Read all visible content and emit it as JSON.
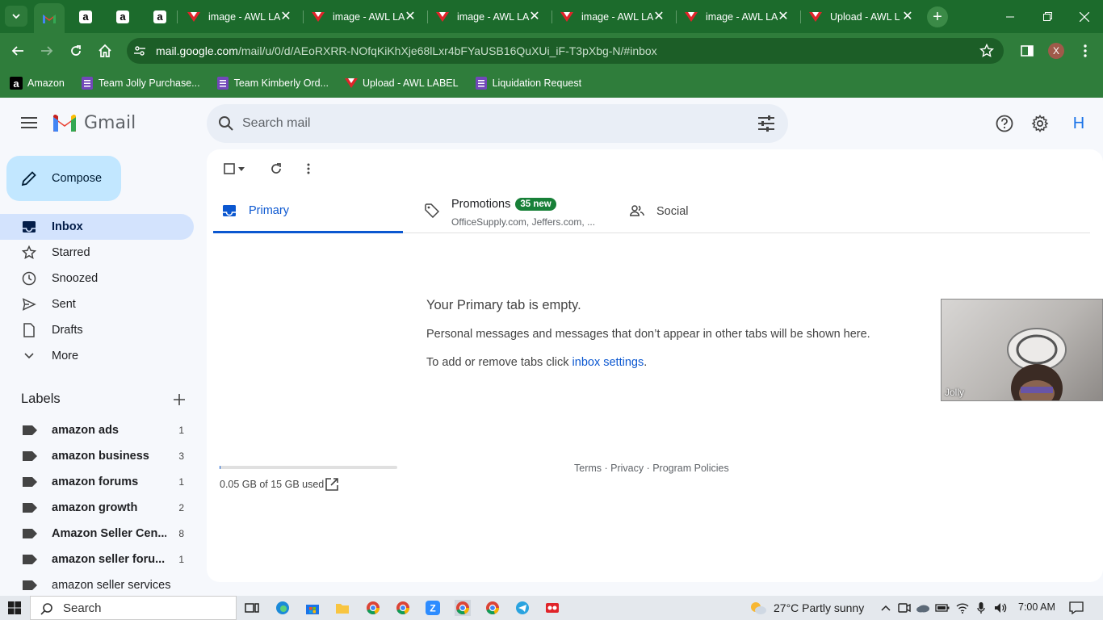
{
  "browser": {
    "tabs": [
      {
        "title": "",
        "icon": "gmail-favicon"
      },
      {
        "title": "",
        "icon": "amazon-favicon"
      },
      {
        "title": "",
        "icon": "amazon-favicon"
      },
      {
        "title": "",
        "icon": "amazon-favicon"
      },
      {
        "title": "image - AWL LA",
        "icon": "awl-favicon"
      },
      {
        "title": "image - AWL LA",
        "icon": "awl-favicon"
      },
      {
        "title": "image - AWL LA",
        "icon": "awl-favicon"
      },
      {
        "title": "image - AWL LA",
        "icon": "awl-favicon"
      },
      {
        "title": "image - AWL LA",
        "icon": "awl-favicon"
      },
      {
        "title": "Upload - AWL L",
        "icon": "awl-favicon"
      }
    ],
    "url_host": "mail.google.com",
    "url_path": "/mail/u/0/d/AEoRXRR-NOfqKiKhXje68lLxr4bFYaUSB16QuXUi_iF-T3pXbg-N/#inbox",
    "profile_initial": "X",
    "bookmarks": [
      {
        "label": "Amazon",
        "icon": "amazon-icon"
      },
      {
        "label": "Team Jolly Purchase...",
        "icon": "forms-icon"
      },
      {
        "label": "Team Kimberly Ord...",
        "icon": "forms-icon"
      },
      {
        "label": "Upload - AWL LABEL",
        "icon": "awl-icon"
      },
      {
        "label": "Liquidation Request",
        "icon": "forms-icon"
      }
    ]
  },
  "gmail": {
    "logo_text": "Gmail",
    "search_placeholder": "Search mail",
    "account_initial": "H",
    "compose_label": "Compose",
    "nav": [
      {
        "label": "Inbox",
        "icon": "inbox-icon",
        "active": true
      },
      {
        "label": "Starred",
        "icon": "star-icon"
      },
      {
        "label": "Snoozed",
        "icon": "clock-icon"
      },
      {
        "label": "Sent",
        "icon": "send-icon"
      },
      {
        "label": "Drafts",
        "icon": "draft-icon"
      },
      {
        "label": "More",
        "icon": "chevron-down-icon"
      }
    ],
    "labels_title": "Labels",
    "labels": [
      {
        "name": "amazon ads",
        "count": "1"
      },
      {
        "name": "amazon business",
        "count": "3"
      },
      {
        "name": "amazon forums",
        "count": "1"
      },
      {
        "name": "amazon growth",
        "count": "2"
      },
      {
        "name": "Amazon Seller Cen...",
        "count": "8"
      },
      {
        "name": "amazon seller foru...",
        "count": "1"
      },
      {
        "name": "amazon seller services",
        "count": ""
      }
    ],
    "tabs": {
      "primary": "Primary",
      "promotions": "Promotions",
      "promotions_badge": "35 new",
      "promotions_sub": "OfficeSupply.com, Jeffers.com, ...",
      "social": "Social"
    },
    "empty": {
      "title": "Your Primary tab is empty.",
      "line1": "Personal messages and messages that don’t appear in other tabs will be shown here.",
      "line2_prefix": "To add or remove tabs click ",
      "line2_link": "inbox settings",
      "line2_suffix": "."
    },
    "storage": {
      "text": "0.05 GB of 15 GB used",
      "used_fraction": 0.0033
    },
    "footer": "Terms · Privacy · Program Policies"
  },
  "video_overlay": {
    "name": "Jolly"
  },
  "taskbar": {
    "search_label": "Search",
    "weather": "27°C  Partly sunny",
    "time": "7:00 AM"
  },
  "colors": {
    "chrome_green": "#2f7d3b",
    "gmail_active": "#d3e3fd",
    "compose": "#c2e7ff",
    "link": "#0b57d0",
    "badge": "#188038"
  }
}
